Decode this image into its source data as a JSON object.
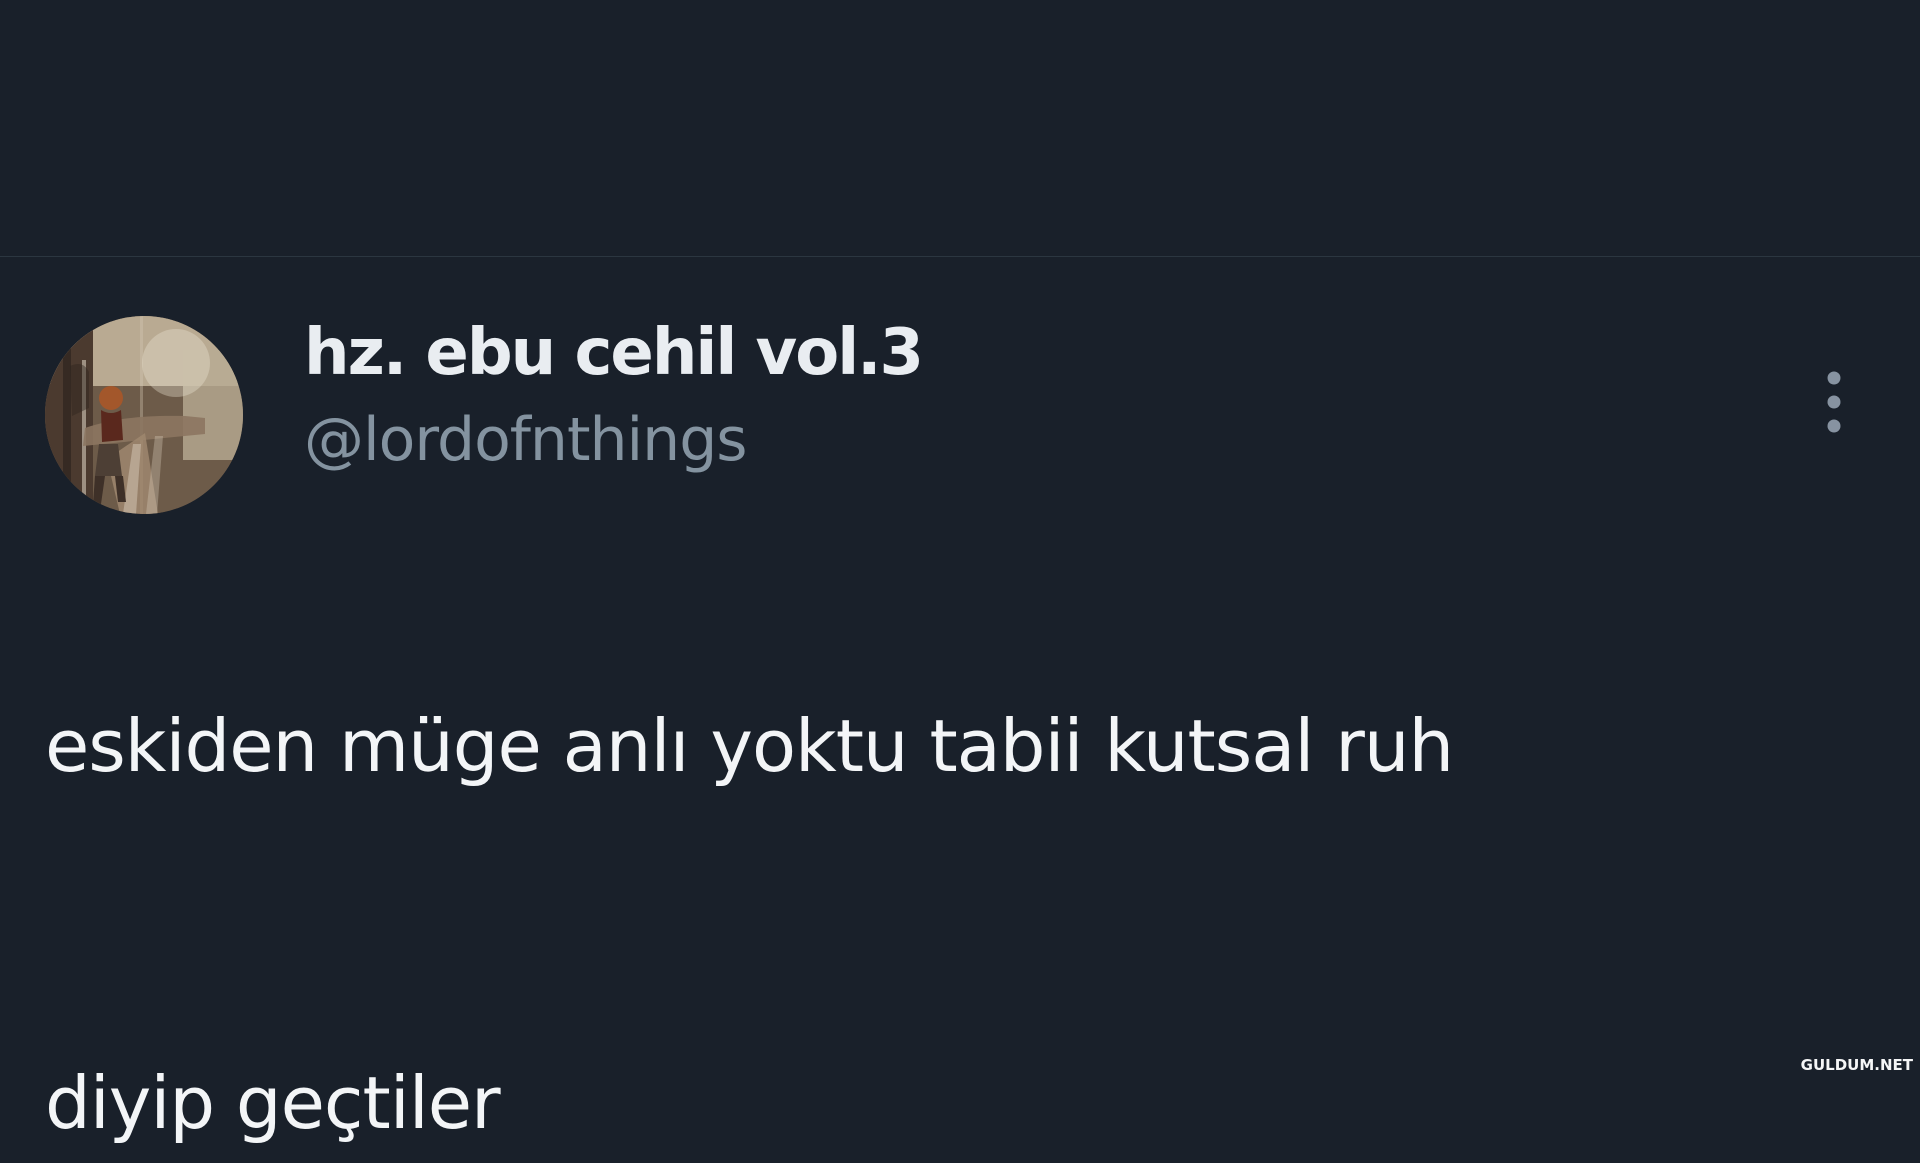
{
  "tweet": {
    "display_name": "hz. ebu cehil vol.3",
    "handle": "@lordofnthings",
    "text_lines": [
      "eskiden müge anlı yoktu tabii kutsal ruh",
      "diyip geçtiler"
    ],
    "more_icon": "more-vertical-icon"
  },
  "watermark": {
    "text": "GULDUM.NET"
  },
  "colors": {
    "background": "#19202a",
    "divider": "#2b3640",
    "display_name": "#e9edf1",
    "handle": "#8493a0",
    "text": "#f3f5f7",
    "icon": "#8793a1"
  }
}
